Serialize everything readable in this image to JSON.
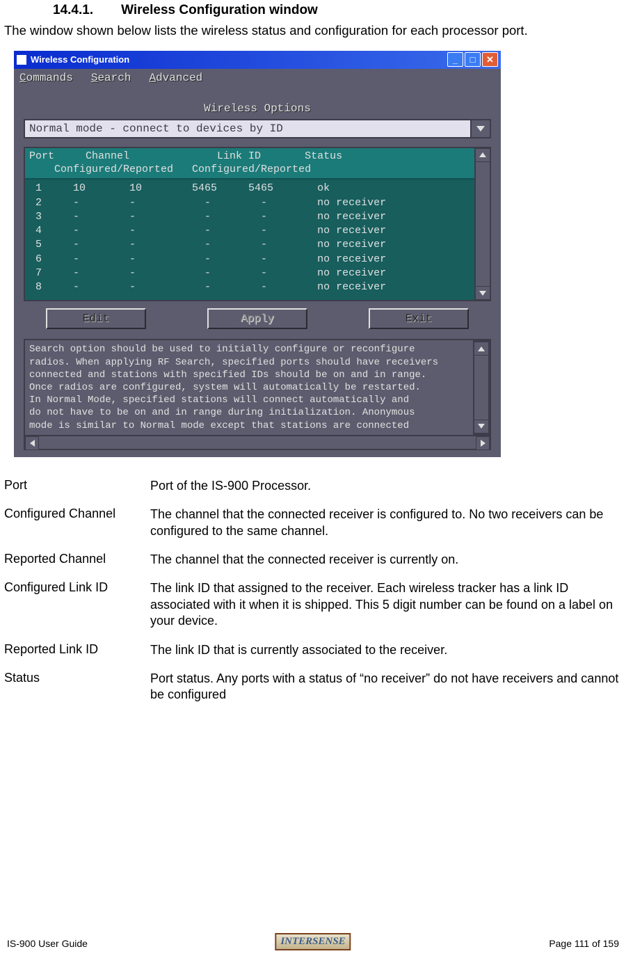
{
  "section": {
    "number": "14.4.1.",
    "title": "Wireless Configuration window"
  },
  "intro": "The window shown below lists the wireless status and configuration for each processor port.",
  "window": {
    "title": "Wireless Configuration",
    "menus": {
      "commands": "Commands",
      "search": "Search",
      "advanced": "Advanced"
    },
    "options_header": "Wireless Options",
    "dropdown": {
      "value": "Normal mode - connect to devices by ID"
    },
    "table": {
      "header_line1": "Port     Channel              Link ID       Status",
      "header_line2": "    Configured/Reported   Configured/Reported",
      "rows": [
        " 1     10       10        5465     5465       ok",
        " 2     -        -           -        -        no receiver",
        " 3     -        -           -        -        no receiver",
        " 4     -        -           -        -        no receiver",
        " 5     -        -           -        -        no receiver",
        " 6     -        -           -        -        no receiver",
        " 7     -        -           -        -        no receiver",
        " 8     -        -           -        -        no receiver"
      ]
    },
    "buttons": {
      "edit": "Edit",
      "apply": "Apply",
      "exit": "Exit"
    },
    "help_text": "Search option should be used to initially configure or reconfigure\nradios. When applying RF Search, specified ports should have receivers\nconnected and stations with specified IDs should be on and in range.\nOnce radios are configured, system will automatically be restarted.\nIn Normal Mode, specified stations will connect automatically and\ndo not have to be on and in range during initialization. Anonymous\nmode is similar to Normal mode except that stations are connected"
  },
  "definitions": [
    {
      "term": "Port",
      "desc": "Port of the IS-900 Processor."
    },
    {
      "term": "Configured Channel",
      "desc": "The channel that the connected receiver is configured to. No two receivers can be configured to the same channel."
    },
    {
      "term": "Reported Channel",
      "desc": "The channel that the connected receiver is currently on."
    },
    {
      "term": "Configured Link ID",
      "desc": "The link ID that assigned to the receiver.  Each wireless tracker has a link ID associated with it when it is shipped.  This 5 digit number can be found on a label on your device."
    },
    {
      "term": "Reported Link ID",
      "desc": "The link ID that is currently associated to the receiver."
    },
    {
      "term": "Status",
      "desc": "Port status.  Any ports with a status of “no receiver” do not have receivers and cannot be configured"
    }
  ],
  "footer": {
    "left": "IS-900 User Guide",
    "right": "Page 111 of 159",
    "logo": "INTERSENSE"
  }
}
